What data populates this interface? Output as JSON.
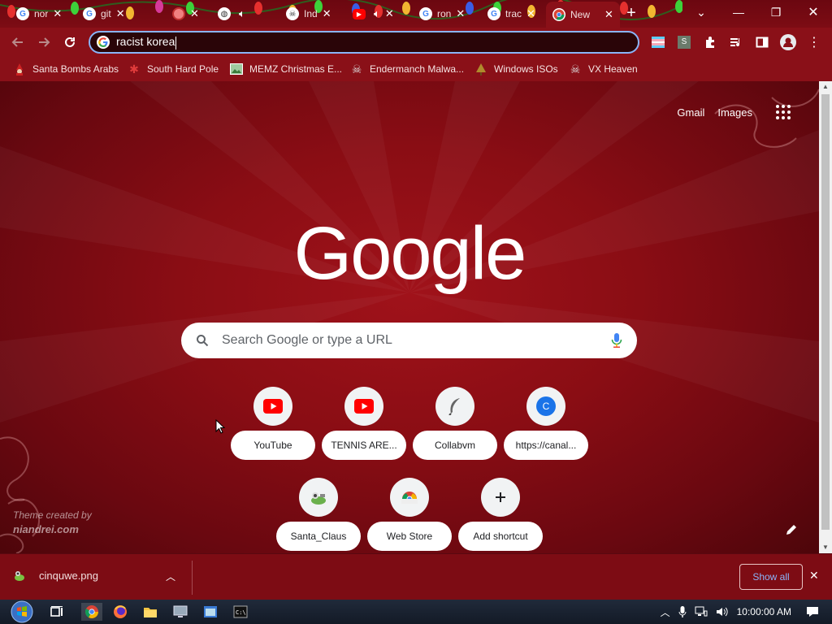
{
  "tabs": [
    {
      "title": "nor",
      "favicon": "google-icon"
    },
    {
      "title": "git",
      "favicon": "google-icon"
    },
    {
      "title": "",
      "favicon": "red-dot-icon"
    },
    {
      "title": "",
      "favicon": "globe-icon"
    },
    {
      "title": "Ind",
      "favicon": "sound-icon"
    },
    {
      "title": "",
      "favicon": "youtube-icon"
    },
    {
      "title": "",
      "favicon": "sound-icon"
    },
    {
      "title": "ron",
      "favicon": "google-icon"
    },
    {
      "title": "trac",
      "favicon": "google-icon"
    },
    {
      "title": "New",
      "favicon": "chrome-icon"
    }
  ],
  "omnibox": {
    "value": "racist korea"
  },
  "bookmarks": [
    {
      "label": "Santa Bombs Arabs",
      "icon": "santa-icon"
    },
    {
      "label": "South Hard Pole",
      "icon": "snowflake-icon"
    },
    {
      "label": "MEMZ Christmas E...",
      "icon": "image-icon"
    },
    {
      "label": "Endermanch Malwa...",
      "icon": "skull-icon"
    },
    {
      "label": "Windows ISOs",
      "icon": "tree-icon"
    },
    {
      "label": "VX Heaven",
      "icon": "skull-icon"
    }
  ],
  "ntp": {
    "gmail": "Gmail",
    "images": "Images",
    "logo": "Google",
    "search_placeholder": "Search Google or type a URL",
    "shortcuts": [
      {
        "label": "YouTube",
        "icon": "youtube-icon"
      },
      {
        "label": "TENNIS ARE...",
        "icon": "youtube-icon"
      },
      {
        "label": "Collabvm",
        "icon": "feather-icon"
      },
      {
        "label": "https://canal...",
        "icon": "letter-c-icon",
        "letter": "C"
      },
      {
        "label": "Santa_Claus",
        "icon": "santa-claus-icon"
      },
      {
        "label": "Web Store",
        "icon": "webstore-icon"
      },
      {
        "label": "Add shortcut",
        "icon": "plus-icon"
      }
    ],
    "credit_line1": "Theme created by",
    "credit_line2": "niandrei.com"
  },
  "downloads": {
    "filename": "cinquwe.png",
    "show_all": "Show all"
  },
  "taskbar": {
    "clock": "10:00:00 AM"
  },
  "colors": {
    "theme_red": "#8a1018",
    "omnibox_focus": "#8ab4f8"
  }
}
